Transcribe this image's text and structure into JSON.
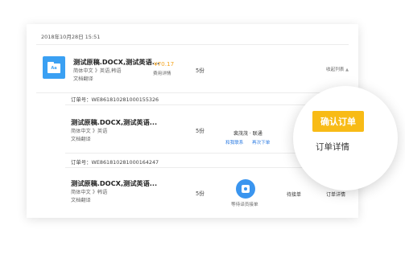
{
  "timestamp": "2018年10月28日 15:51",
  "main_order": {
    "file_icon_text": "Aa",
    "title": "测试原稿.DOCX,测试英语...",
    "langs": "简体中文 》英语,韩语",
    "service": "文档翻译",
    "price": "¥70.17",
    "price_detail": "费用详情",
    "quantity": "5份",
    "collapse_label": "收起列表",
    "collapse_icon": "chevron-up-icon"
  },
  "sub_orders": [
    {
      "order_no": "订单号：WE861810281000155326",
      "title": "测试原稿.DOCX,测试英语...",
      "langs": "简体中文 》英语",
      "service": "文档翻译",
      "quantity": "5份",
      "translator": "裴茂茂 · 联通",
      "contact_link": "和我联系",
      "reorder_link": "再次下单"
    },
    {
      "order_no": "订单号：WE861810281000164247",
      "title": "测试原稿.DOCX,测试英语...",
      "langs": "简体中文 》韩语",
      "service": "文档翻译",
      "quantity": "5份",
      "assign_status": "等待译员接单",
      "status": "待接单",
      "detail_link": "订单详情"
    }
  ],
  "bubble": {
    "confirm_label": "确认订单",
    "detail_label": "订单详情",
    "confirm_color": "#f8bb16"
  }
}
